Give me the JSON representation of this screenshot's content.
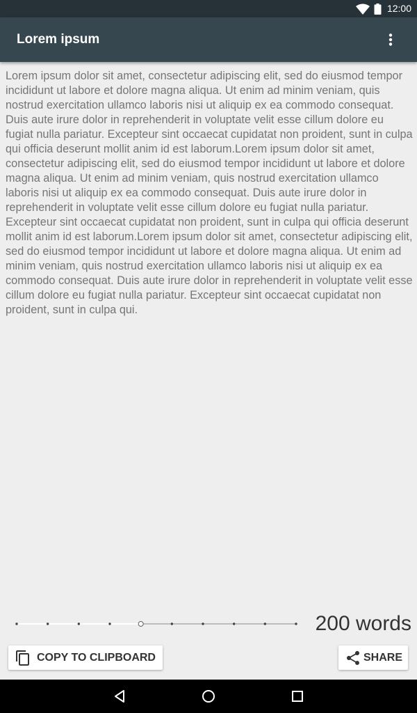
{
  "status_bar": {
    "time": "12:00",
    "icons": [
      "wifi-icon",
      "battery-icon"
    ]
  },
  "app_bar": {
    "title": "Lorem ipsum",
    "overflow_icon": "more-vert-icon"
  },
  "content": {
    "text": "Lorem ipsum dolor sit amet, consectetur adipiscing elit, sed do eiusmod tempor incididunt ut labore et dolore magna aliqua. Ut enim ad minim veniam, quis nostrud exercitation ullamco laboris nisi ut aliquip ex ea commodo consequat. Duis aute irure dolor in reprehenderit in voluptate velit esse cillum dolore eu fugiat nulla pariatur. Excepteur sint occaecat cupidatat non proident, sunt in culpa qui officia deserunt mollit anim id est laborum.Lorem ipsum dolor sit amet, consectetur adipiscing elit, sed do eiusmod tempor incididunt ut labore et dolore magna aliqua. Ut enim ad minim veniam, quis nostrud exercitation ullamco laboris nisi ut aliquip ex ea commodo consequat. Duis aute irure dolor in reprehenderit in voluptate velit esse cillum dolore eu fugiat nulla pariatur. Excepteur sint occaecat cupidatat non proident, sunt in culpa qui officia deserunt mollit anim id est laborum.Lorem ipsum dolor sit amet, consectetur adipiscing elit, sed do eiusmod tempor incididunt ut labore et dolore magna aliqua. Ut enim ad minim veniam, quis nostrud exercitation ullamco laboris nisi ut aliquip ex ea commodo consequat. Duis aute irure dolor in reprehenderit in voluptate velit esse cillum dolore eu fugiat nulla pariatur. Excepteur sint occaecat cupidatat non proident, sunt in culpa qui."
  },
  "word_slider": {
    "steps": 10,
    "selected_step": 4,
    "label": "200 words"
  },
  "actions": {
    "copy_label": "COPY TO CLIPBOARD",
    "copy_icon": "content-copy-icon",
    "share_label": "SHARE",
    "share_icon": "share-icon"
  },
  "nav_bar": {
    "icons": [
      "back-icon",
      "home-icon",
      "recents-icon"
    ]
  },
  "colors": {
    "status_bar": "#263238",
    "app_bar": "#37474f",
    "background": "#eeeeee",
    "body_text": "#757575"
  }
}
